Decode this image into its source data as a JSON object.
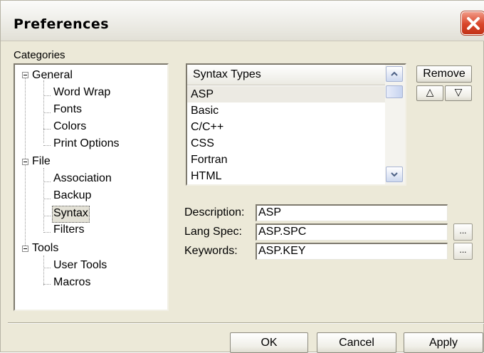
{
  "window": {
    "title": "Preferences"
  },
  "categories": {
    "label": "Categories",
    "tree": {
      "general": "General",
      "general_children": [
        "Word Wrap",
        "Fonts",
        "Colors",
        "Print Options"
      ],
      "file": "File",
      "file_children": [
        "Association",
        "Backup",
        "Syntax",
        "Filters"
      ],
      "tools": "Tools",
      "tools_children": [
        "User Tools",
        "Macros"
      ],
      "selected": "Syntax"
    }
  },
  "syntax_list": {
    "header": "Syntax Types",
    "items": [
      "ASP",
      "Basic",
      "C/C++",
      "CSS",
      "Fortran",
      "HTML"
    ],
    "selected": "ASP"
  },
  "side_buttons": {
    "remove": "Remove",
    "move_up": "△",
    "move_down": "▽"
  },
  "form": {
    "description_label": "Description:",
    "description_value": "ASP",
    "lang_spec_label": "Lang Spec:",
    "lang_spec_value": "ASP.SPC",
    "keywords_label": "Keywords:",
    "keywords_value": "ASP.KEY",
    "browse_label": "..."
  },
  "footer": {
    "ok": "OK",
    "cancel": "Cancel",
    "apply": "Apply"
  },
  "colors": {
    "dialog_bg": "#ece9d8",
    "close_button": "#d9452a"
  }
}
